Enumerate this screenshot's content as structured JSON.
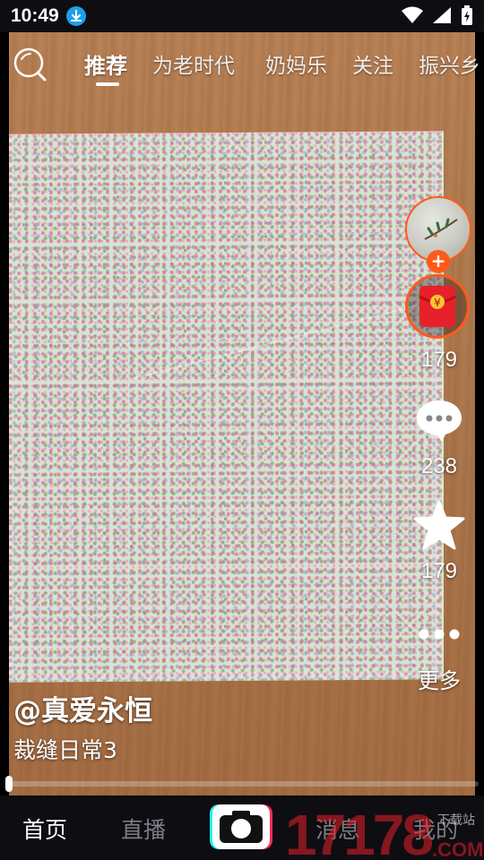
{
  "status_bar": {
    "time": "10:49"
  },
  "top_tabs": {
    "items": [
      "推荐",
      "为老时代",
      "奶妈乐",
      "关注",
      "振兴乡"
    ],
    "active_index": 0
  },
  "right_rail": {
    "like_count": "179",
    "comment_count": "238",
    "favorite_count": "179",
    "more_label": "更多",
    "follow_symbol": "+",
    "redpacket_symbol": "¥"
  },
  "video": {
    "author": "@真爱永恒",
    "description": "裁缝日常3",
    "progress_fraction": 0.0
  },
  "bottom_nav": {
    "items": [
      "首页",
      "直播",
      "消息",
      "我的"
    ],
    "active_index": 0
  },
  "watermark": {
    "text": "17178",
    "suffix": ".COM",
    "tag": "下载站"
  },
  "colors": {
    "accent_orange": "#ff5a1a",
    "nav_bg": "#0e0d12",
    "camera_cyan": "#25f4ee",
    "camera_red": "#fe2c55"
  }
}
